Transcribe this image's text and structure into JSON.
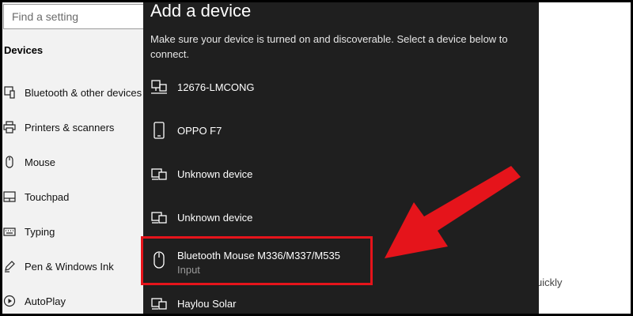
{
  "settings": {
    "search_placeholder": "Find a setting",
    "section_title": "Devices",
    "nav_items": [
      {
        "label": "Bluetooth & other devices",
        "icon": "bluetooth-devices-icon"
      },
      {
        "label": "Printers & scanners",
        "icon": "printer-icon"
      },
      {
        "label": "Mouse",
        "icon": "mouse-icon"
      },
      {
        "label": "Touchpad",
        "icon": "touchpad-icon"
      },
      {
        "label": "Typing",
        "icon": "keyboard-icon"
      },
      {
        "label": "Pen & Windows Ink",
        "icon": "pen-icon"
      },
      {
        "label": "AutoPlay",
        "icon": "autoplay-icon"
      }
    ]
  },
  "background_text": "uickly",
  "dialog": {
    "title": "Add a device",
    "description": "Make sure your device is turned on and discoverable. Select a device below to connect.",
    "devices": [
      {
        "name": "12676-LMCONG",
        "icon": "computer-icon"
      },
      {
        "name": "OPPO F7",
        "icon": "phone-icon"
      },
      {
        "name": "Unknown device",
        "icon": "generic-device-icon"
      },
      {
        "name": "Unknown device",
        "icon": "generic-device-icon"
      },
      {
        "name": "Bluetooth Mouse M336/M337/M535",
        "subtitle": "Input",
        "icon": "mouse-icon"
      },
      {
        "name": "Haylou Solar",
        "icon": "generic-device-icon"
      }
    ]
  },
  "colors": {
    "dialog_bg": "#1f1f1f",
    "settings_bg": "#f2f2f2",
    "highlight": "#e5141b"
  }
}
